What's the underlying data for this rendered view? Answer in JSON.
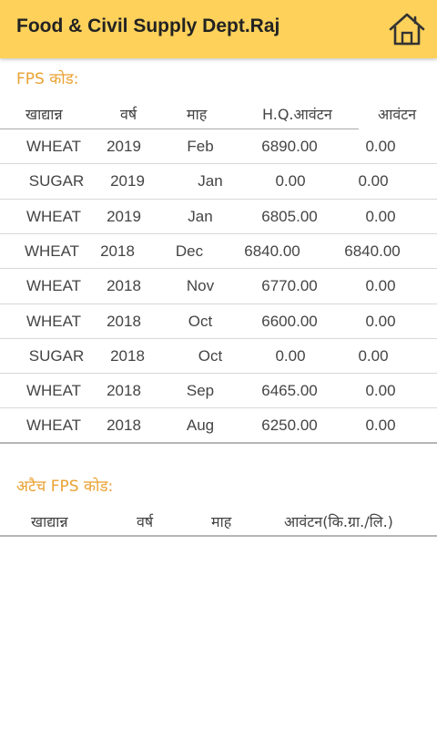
{
  "app_bar": {
    "title": "Food & Civil Supply Dept.Raj",
    "home_icon": "home-icon",
    "background_color": "#fdd15a"
  },
  "fps_section": {
    "label": "FPS कोड:",
    "columns": [
      "खाद्यान्न",
      "वर्ष",
      "माह",
      "H.Q.आवंटन",
      "आवंटन"
    ],
    "rows": [
      [
        "WHEAT",
        "2019",
        "Feb",
        "6890.00",
        "0.00"
      ],
      [
        "SUGAR",
        "2019",
        "Jan",
        "0.00",
        "0.00"
      ],
      [
        "WHEAT",
        "2019",
        "Jan",
        "6805.00",
        "0.00"
      ],
      [
        "WHEAT",
        "2018",
        "Dec",
        "6840.00",
        "6840.00"
      ],
      [
        "WHEAT",
        "2018",
        "Nov",
        "6770.00",
        "0.00"
      ],
      [
        "WHEAT",
        "2018",
        "Oct",
        "6600.00",
        "0.00"
      ],
      [
        "SUGAR",
        "2018",
        "Oct",
        "0.00",
        "0.00"
      ],
      [
        "WHEAT",
        "2018",
        "Sep",
        "6465.00",
        "0.00"
      ],
      [
        "WHEAT",
        "2018",
        "Aug",
        "6250.00",
        "0.00"
      ]
    ]
  },
  "attached_section": {
    "label": "अटैच FPS कोड:",
    "columns": [
      "खाद्यान्न",
      "वर्ष",
      "माह",
      "आवंटन(कि.ग्रा./लि.)"
    ]
  },
  "colors": {
    "accent": "#e9a233",
    "text": "#444444",
    "divider": "#d8d8d8"
  }
}
